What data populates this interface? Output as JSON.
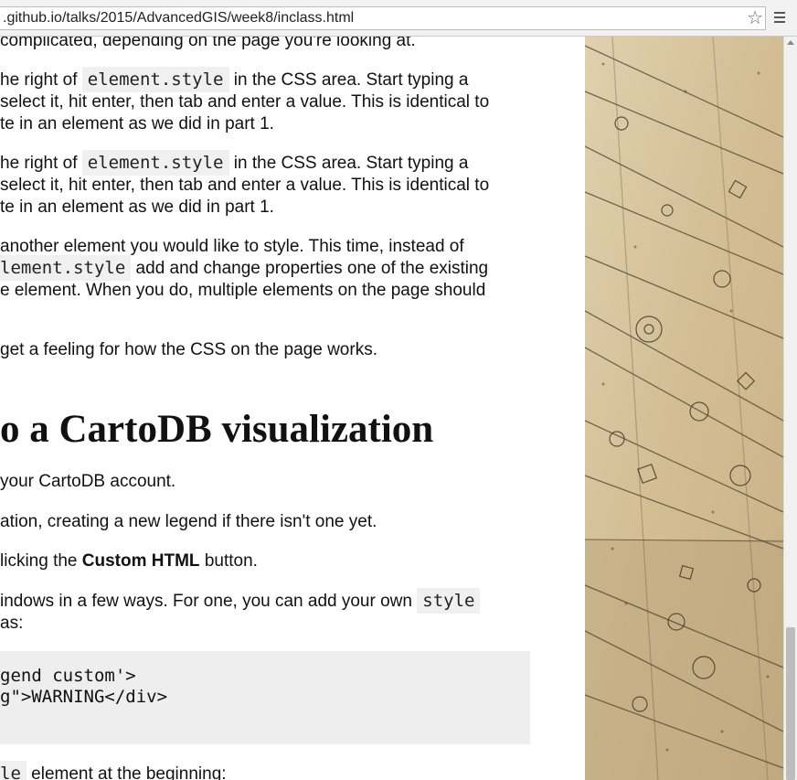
{
  "browser": {
    "url": ".github.io/talks/2015/AdvancedGIS/week8/inclass.html",
    "bookmark_icon": "star-icon",
    "menu_icon": "hamburger-menu-icon"
  },
  "article": {
    "paragraph_0": {
      "line1": "complicated, depending on the page you're looking at."
    },
    "paragraph_1": {
      "pre": "he right of ",
      "code": "element.style",
      "post": " in the CSS area. Start typing a",
      "line2": "select it, hit enter, then tab and enter a value. This is identical to",
      "line3": "te in an element as we did in part 1."
    },
    "paragraph_2": {
      "pre": "he right of ",
      "code": "element.style",
      "post": " in the CSS area. Start typing a",
      "line2": "select it, hit enter, then tab and enter a value. This is identical to",
      "line3": "te in an element as we did in part 1."
    },
    "paragraph_3": {
      "line1": " another element you would like to style. This time, instead of",
      "code": "lement.style",
      "post": " add and change properties one of the existing",
      "line3": "e element. When you do, multiple elements on the page should"
    },
    "paragraph_4": {
      "line1": " get a feeling for how the CSS on the page works."
    },
    "heading": "o a CartoDB visualization",
    "paragraph_5": {
      "line1": " your CartoDB account."
    },
    "paragraph_6": {
      "line1": "ation, creating a new legend if there isn't one yet."
    },
    "paragraph_7": {
      "pre": "licking the ",
      "bold": "Custom HTML",
      "post": " button."
    },
    "paragraph_8": {
      "pre": "indows in a few ways. For one, you can add your own ",
      "code": "style",
      "line2": "as:"
    },
    "code_block": {
      "line1": "gend custom'>",
      "line2": "g\">WARNING</div>"
    },
    "paragraph_9": {
      "code": "le",
      "post": " element at the beginning:"
    }
  },
  "sidebar_image": {
    "description_icon": "aerial-map-image"
  },
  "colors": {
    "code_bg": "#f0f0f0",
    "codeblock_bg": "#eeeeee",
    "aerial_base": "#d8c6a1"
  }
}
